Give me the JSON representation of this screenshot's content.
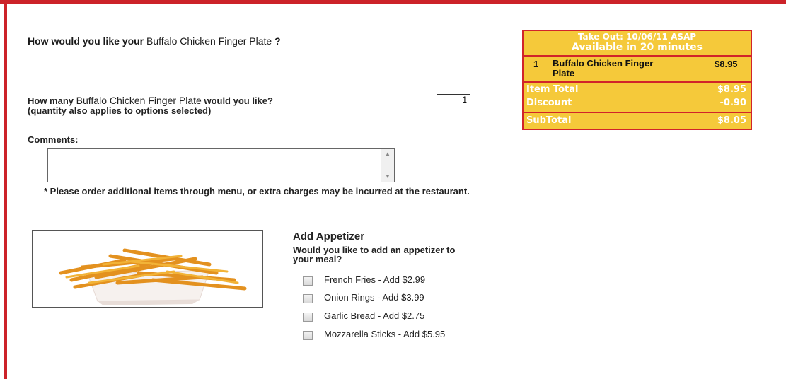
{
  "question": {
    "prefix": "How would you like your",
    "item_name": "Buffalo Chicken Finger Plate",
    "suffix": "?"
  },
  "quantity": {
    "prefix": "How many",
    "item_name": "Buffalo Chicken Finger Plate",
    "suffix": "would you like?",
    "value": "1",
    "note": "(quantity also applies to options selected)"
  },
  "comments": {
    "label": "Comments:",
    "value": "",
    "scroll_up_icon": "triangle-up",
    "scroll_down_icon": "triangle-down"
  },
  "notice": "* Please order additional items through menu, or extra charges may be incurred at the restaurant.",
  "appetizer": {
    "title": "Add Appetizer",
    "question": "Would you like to add an appetizer to your meal?",
    "options": [
      {
        "label": "French Fries - Add $2.99",
        "checked": false
      },
      {
        "label": "Onion Rings - Add $3.99",
        "checked": false
      },
      {
        "label": "Garlic Bread - Add $2.75",
        "checked": false
      },
      {
        "label": "Mozzarella Sticks - Add $5.95",
        "checked": false
      }
    ]
  },
  "order_summary": {
    "header_line1": "Take Out: 10/06/11 ASAP",
    "header_line2": "Available in 20 minutes",
    "items": [
      {
        "qty": "1",
        "name": "Buffalo Chicken Finger Plate",
        "price": "$8.95"
      }
    ],
    "totals": [
      {
        "label": "Item Total",
        "value": "$8.95"
      },
      {
        "label": "Discount",
        "value": "-0.90"
      },
      {
        "label": "SubTotal",
        "value": "$8.05"
      }
    ]
  },
  "colors": {
    "accent_red": "#cc2229",
    "summary_yellow": "#f5c93a"
  }
}
